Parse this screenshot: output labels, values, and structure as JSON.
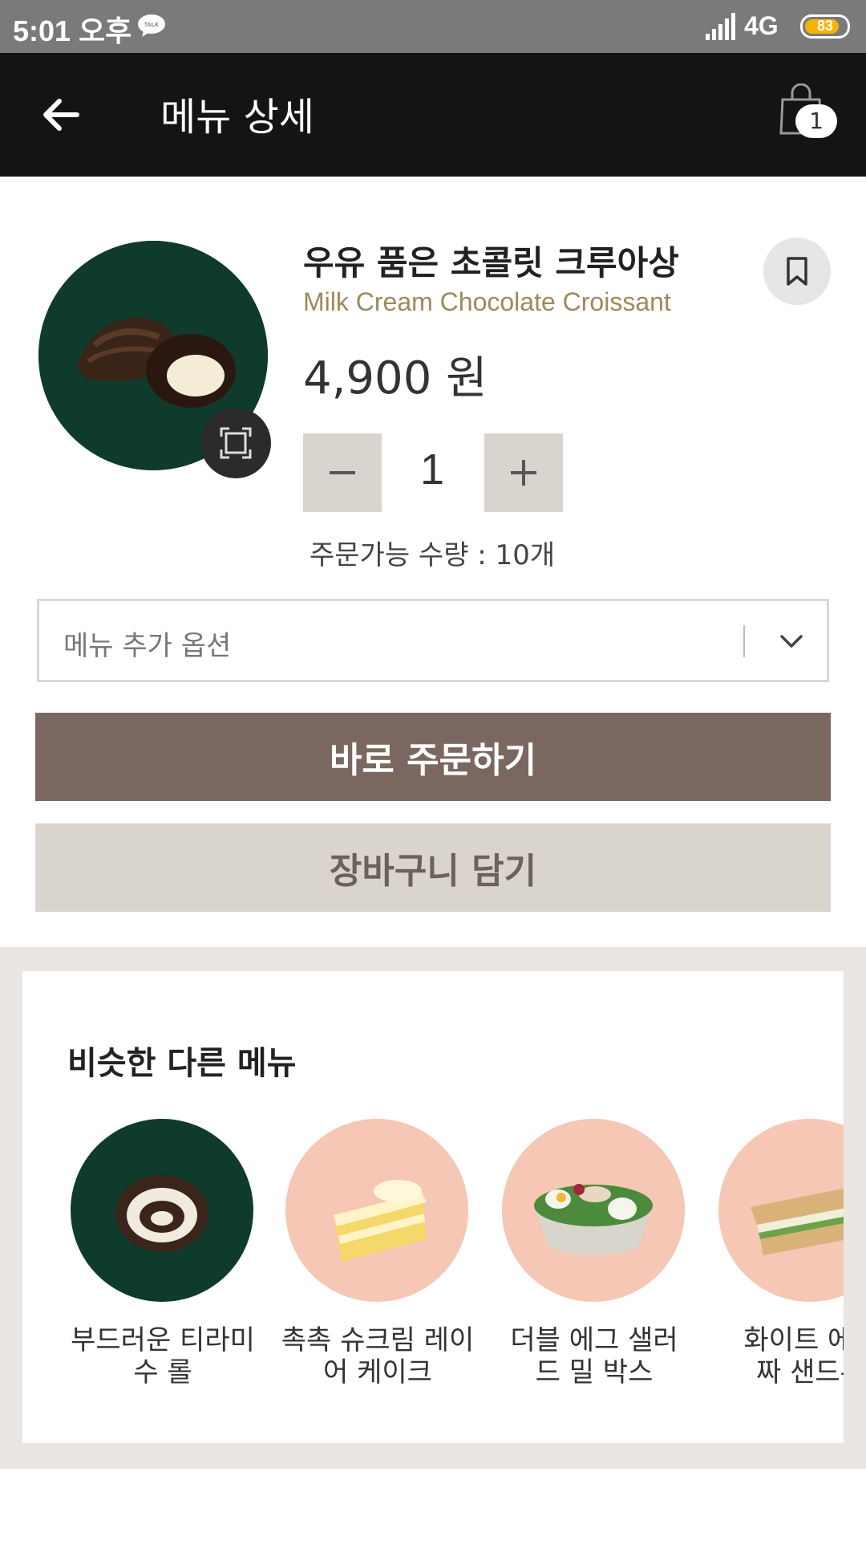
{
  "status_bar": {
    "time": "5:01 오후",
    "network": "4G",
    "battery": "83",
    "battery_level": 0.83
  },
  "header": {
    "title": "메뉴 상세",
    "cart_count": "1"
  },
  "product": {
    "name_ko": "우유 품은 초콜릿 크루아상",
    "name_en": "Milk Cream Chocolate Croissant",
    "price": "4,900 원",
    "quantity": "1",
    "available_quantity": "주문가능 수량 : 10개"
  },
  "options": {
    "placeholder": "메뉴 추가 옵션"
  },
  "actions": {
    "order_now": "바로 주문하기",
    "add_to_cart": "장바구니 담기"
  },
  "similar": {
    "title": "비슷한 다른 메뉴",
    "items": [
      {
        "line1": "부드러운 티라미",
        "line2": "수 롤"
      },
      {
        "line1": "촉촉 슈크림 레이",
        "line2": "어 케이크"
      },
      {
        "line1": "더블 에그 샐러",
        "line2": "드 밀 박스"
      },
      {
        "line1": "화이트 에그",
        "line2": "짜 샌드우"
      }
    ]
  },
  "colors": {
    "header_bg": "#141414",
    "primary_button": "#7a6860",
    "secondary_button": "#d9d4ce",
    "accent_gold": "#9c8a5a",
    "dark_green": "#0f3b2c",
    "peach": "#f6c7b4"
  },
  "icons": {
    "back": "arrow-left-icon",
    "cart": "shopping-bag-icon",
    "bookmark": "bookmark-icon",
    "zoom": "fullscreen-icon",
    "dropdown": "chevron-down-icon",
    "minus": "minus-icon",
    "plus": "plus-icon"
  }
}
